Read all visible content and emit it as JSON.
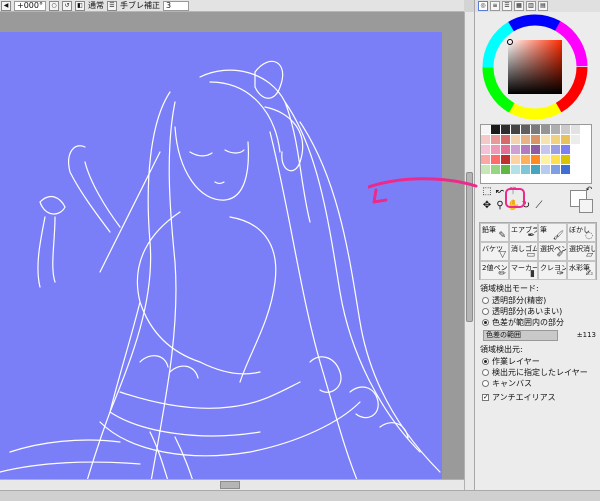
{
  "toolbar": {
    "angle": "+000°",
    "blend_mode": "通常",
    "stabilizer_label": "手ブレ補正",
    "stabilizer_value": "3"
  },
  "tools": {
    "panel_tabs": [
      "circle-icon",
      "bars-icon",
      "slider-icon",
      "chart-icon",
      "palette-icon",
      "grid-icon"
    ],
    "brushes": [
      {
        "label": "鉛筆",
        "icon": "pencil-icon"
      },
      {
        "label": "エアブラシ",
        "icon": "airbrush-icon"
      },
      {
        "label": "筆",
        "icon": "brush-icon"
      },
      {
        "label": "ぼかし",
        "icon": "blur-icon"
      },
      {
        "label": "バケツ",
        "icon": "bucket-icon"
      },
      {
        "label": "消しゴム",
        "icon": "eraser-icon"
      },
      {
        "label": "選択ペン",
        "icon": "select-pen-icon"
      },
      {
        "label": "選択消し",
        "icon": "select-erase-icon"
      },
      {
        "label": "2値ペン",
        "icon": "binary-pen-icon"
      },
      {
        "label": "マーカー",
        "icon": "marker-icon"
      },
      {
        "label": "クレヨン",
        "icon": "crayon-icon"
      },
      {
        "label": "水彩筆",
        "icon": "watercolor-icon"
      }
    ]
  },
  "options": {
    "detect_mode_label": "領域検出モード:",
    "detect_modes": [
      "透明部分(精密)",
      "透明部分(あいまい)",
      "色差が範囲内の部分"
    ],
    "selected_mode_index": 2,
    "range_label": "色差の範囲",
    "range_value": "±113",
    "source_label": "領域検出元:",
    "sources": [
      "作業レイヤー",
      "検出元に指定したレイヤー",
      "キャンバス"
    ],
    "selected_source_index": 0,
    "antialias_label": "アンチエイリアス",
    "antialias_checked": true
  },
  "colors": {
    "canvas_bg": "#7b7ff7",
    "highlight": "#ec2a8c",
    "palette": [
      "#f5f5f5",
      "#1a1a1a",
      "#2d2d2d",
      "#444444",
      "#5f5f5f",
      "#7a7a7a",
      "#959595",
      "#b0b0b0",
      "#cbcbcb",
      "#e2e2e2",
      "#ffffff",
      "#f4c9c9",
      "#e89a9a",
      "#d46a6a",
      "#f3d2b2",
      "#e6b486",
      "#d99566",
      "#f7e3b0",
      "#f1d27e",
      "#e7c25b",
      "#ececec",
      "#ffffff",
      "#f7c2d6",
      "#ef99b6",
      "#e07095",
      "#cfa0d6",
      "#b27bbf",
      "#8e5aa3",
      "#c4c6f0",
      "#9a9fe3",
      "#7a7ff2",
      "#ffffff",
      "#ffffff",
      "#f9a7a7",
      "#ff6a6a",
      "#c12e2e",
      "#ffd3a1",
      "#ffb15a",
      "#ff8a1f",
      "#fff2a0",
      "#ffe14d",
      "#d9c400",
      "#ffffff",
      "#ffffff",
      "#c7e8b6",
      "#98d481",
      "#5fb843",
      "#b2e1e8",
      "#7fc7d6",
      "#45a5bf",
      "#b7cbee",
      "#7f9fe3",
      "#3f6ed4",
      "#ffffff",
      "#ffffff"
    ]
  }
}
